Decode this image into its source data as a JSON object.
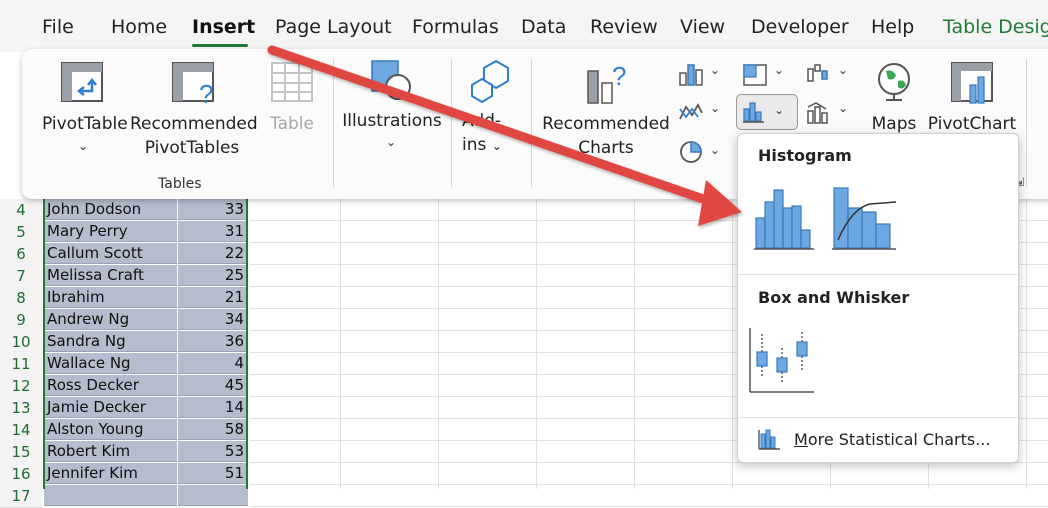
{
  "menu": {
    "tabs": [
      {
        "label": "File"
      },
      {
        "label": "Home"
      },
      {
        "label": "Insert"
      },
      {
        "label": "Page Layout"
      },
      {
        "label": "Formulas"
      },
      {
        "label": "Data"
      },
      {
        "label": "Review"
      },
      {
        "label": "View"
      },
      {
        "label": "Developer"
      },
      {
        "label": "Help"
      },
      {
        "label": "Table Design"
      }
    ]
  },
  "ribbon": {
    "pivot_table_label": "PivotTable",
    "recommended_pivot_line1": "Recommended",
    "recommended_pivot_line2": "PivotTables",
    "table_label": "Table",
    "tables_group_caption": "Tables",
    "illustrations_label": "Illustrations",
    "addins_line1": "Add-",
    "addins_line2": "ins",
    "recommended_charts_line1": "Recommended",
    "recommended_charts_line2": "Charts",
    "maps_label": "Maps",
    "pivotchart_label": "PivotChart"
  },
  "dropdown": {
    "histogram_heading": "Histogram",
    "box_whisker_heading": "Box and Whisker",
    "more_prefix": "M",
    "more_rest": "ore Statistical Charts..."
  },
  "sheet": {
    "rows": [
      {
        "num": "4",
        "name": "John Dodson",
        "age": "33"
      },
      {
        "num": "5",
        "name": "Mary Perry",
        "age": "31"
      },
      {
        "num": "6",
        "name": "Callum Scott",
        "age": "22"
      },
      {
        "num": "7",
        "name": "Melissa Craft",
        "age": "25"
      },
      {
        "num": "8",
        "name": "Ibrahim Gallagher",
        "age": "21"
      },
      {
        "num": "9",
        "name": "Andrew Ng",
        "age": "34"
      },
      {
        "num": "10",
        "name": "Sandra Ng",
        "age": "36"
      },
      {
        "num": "11",
        "name": "Wallace Ng",
        "age": "4"
      },
      {
        "num": "12",
        "name": "Ross Decker",
        "age": "45"
      },
      {
        "num": "13",
        "name": "Jamie Decker",
        "age": "14"
      },
      {
        "num": "14",
        "name": "Alston Young",
        "age": "58"
      },
      {
        "num": "15",
        "name": "Robert Kim",
        "age": "53"
      },
      {
        "num": "16",
        "name": "Jennifer Kim",
        "age": "51"
      },
      {
        "num": "17",
        "name": "",
        "age": ""
      }
    ]
  },
  "colors": {
    "accent_green": "#1e7b34",
    "arrow_red": "#e0473f",
    "chart_blue": "#4a90d9",
    "table_fill": "#b4bccd"
  }
}
